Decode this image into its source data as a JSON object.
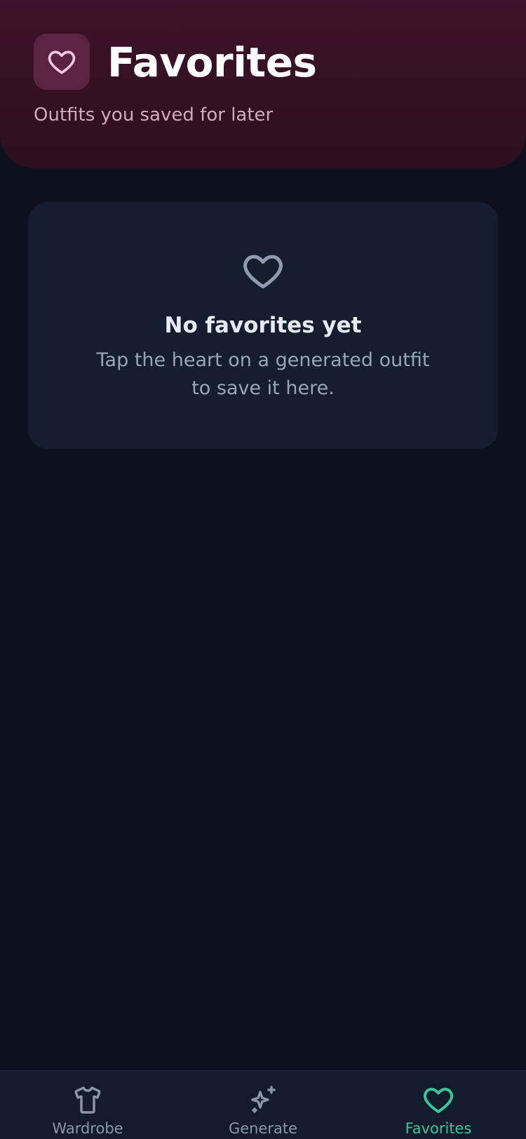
{
  "header": {
    "icon": "heart-icon",
    "title": "Favorites",
    "subtitle": "Outfits you saved for later"
  },
  "empty_state": {
    "icon": "heart-outline-icon",
    "title": "No favorites yet",
    "message": "Tap the heart on a generated outfit to save it here."
  },
  "tabbar": {
    "tabs": [
      {
        "label": "Wardrobe",
        "icon": "shirt-icon",
        "active": false
      },
      {
        "label": "Generate",
        "icon": "sparkles-icon",
        "active": false
      },
      {
        "label": "Favorites",
        "icon": "heart-icon",
        "active": true
      }
    ]
  },
  "colors": {
    "background": "#0c111d",
    "header": "#3e1228",
    "card": "#141e2e",
    "accent": "#34c89a",
    "inactive": "#8c97a8"
  }
}
